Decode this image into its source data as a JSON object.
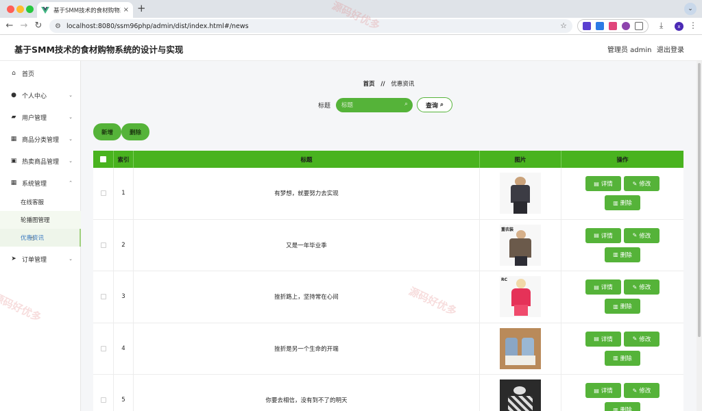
{
  "browser": {
    "tab_title": "基于SMM技术的食材购物系统的设计与实现",
    "tab_close": "×",
    "new_tab": "+",
    "url": "localhost:8080/ssm96php/admin/dist/index.html#/news",
    "profile_initial": "x"
  },
  "header": {
    "title": "基于SMM技术的食材购物系统的设计与实现",
    "admin": "管理员 admin",
    "logout": "退出登录"
  },
  "sidebar": {
    "items": [
      {
        "label": "首页",
        "icon": "home-icon",
        "arrow": ""
      },
      {
        "label": "个人中心",
        "icon": "user-icon",
        "arrow": "⌄"
      },
      {
        "label": "用户管理",
        "icon": "user-manage-icon",
        "arrow": "⌄"
      },
      {
        "label": "商品分类管理",
        "icon": "grid-icon",
        "arrow": "⌄"
      },
      {
        "label": "热卖商品管理",
        "icon": "clipboard-icon",
        "arrow": "⌄"
      },
      {
        "label": "系统管理",
        "icon": "grid-icon",
        "arrow": "⌃"
      },
      {
        "label": "订单管理",
        "icon": "send-icon",
        "arrow": "⌄"
      }
    ],
    "sub_items": [
      "在线客服",
      "轮播图管理",
      "优惠资讯"
    ]
  },
  "breadcrumb": {
    "home": "首页",
    "sep": "//",
    "current": "优惠资讯"
  },
  "search": {
    "label": "标题",
    "placeholder": "标题",
    "button": "查询"
  },
  "actions": {
    "add": "新增",
    "delete": "删除"
  },
  "table": {
    "headers": {
      "index": "索引",
      "title": "标题",
      "image": "图片",
      "ops": "操作"
    },
    "rows": [
      {
        "index": "1",
        "title": "有梦想，就要努力去实现",
        "thumb_label": ""
      },
      {
        "index": "2",
        "title": "又是一年毕业季",
        "thumb_label": "重农装"
      },
      {
        "index": "3",
        "title": "挫折路上，坚持常在心间",
        "thumb_label": "RC"
      },
      {
        "index": "4",
        "title": "挫折是另一个生命的开端",
        "thumb_label": ""
      },
      {
        "index": "5",
        "title": "你要去相信，没有到不了的明天",
        "thumb_label": ""
      }
    ],
    "op_labels": {
      "detail": "详情",
      "edit": "修改",
      "remove": "删除"
    }
  },
  "watermark": "源码好优多",
  "colors": {
    "primary": "#55b339",
    "header_green": "#49b31f"
  }
}
